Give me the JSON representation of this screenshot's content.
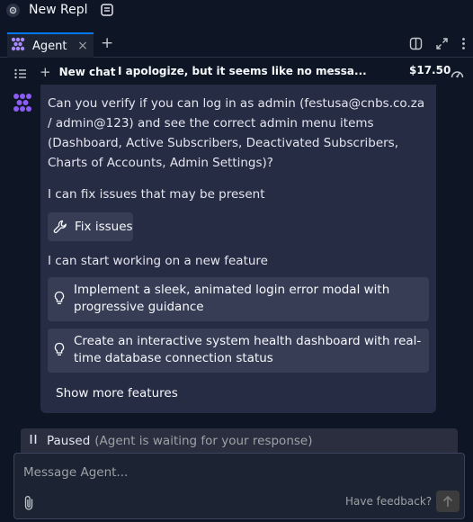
{
  "titlebar": {
    "title": "New Repl"
  },
  "tabs": [
    {
      "label": "Agent",
      "close": "×"
    }
  ],
  "tab_add": "+",
  "chatbar": {
    "new_chat_label": "New chat",
    "new_chat_plus": "+",
    "chat_title": "I apologize, but it seems like no messa...",
    "chevron": "⌄",
    "cost": "$17.50"
  },
  "message": {
    "intro": "Can you verify if you can log in as admin (festusa@cnbs.co.za / admin@123) and see the correct admin menu items (Dashboard, Active Subscribers, Deactivated Subscribers, Charts of Accounts, Admin Settings)?",
    "fix_heading": "I can fix issues that may be present",
    "fix_button": "Fix issues",
    "feature_heading": "I can start working on a new feature",
    "features": [
      {
        "label": "Implement a sleek, animated login error modal with progressive guidance"
      },
      {
        "label": "Create an interactive system health dashboard with real-time database connection status"
      }
    ],
    "show_more": "Show more features"
  },
  "status": {
    "label": "Paused",
    "note": "(Agent is waiting for your response)"
  },
  "composer": {
    "placeholder": "Message Agent...",
    "value": "",
    "feedback": "Have feedback?"
  },
  "colors": {
    "background": "#0e1525",
    "card": "#272c45",
    "button": "#383d56",
    "accent": "#0079f2",
    "agent_logo": "#8b5cf6"
  }
}
